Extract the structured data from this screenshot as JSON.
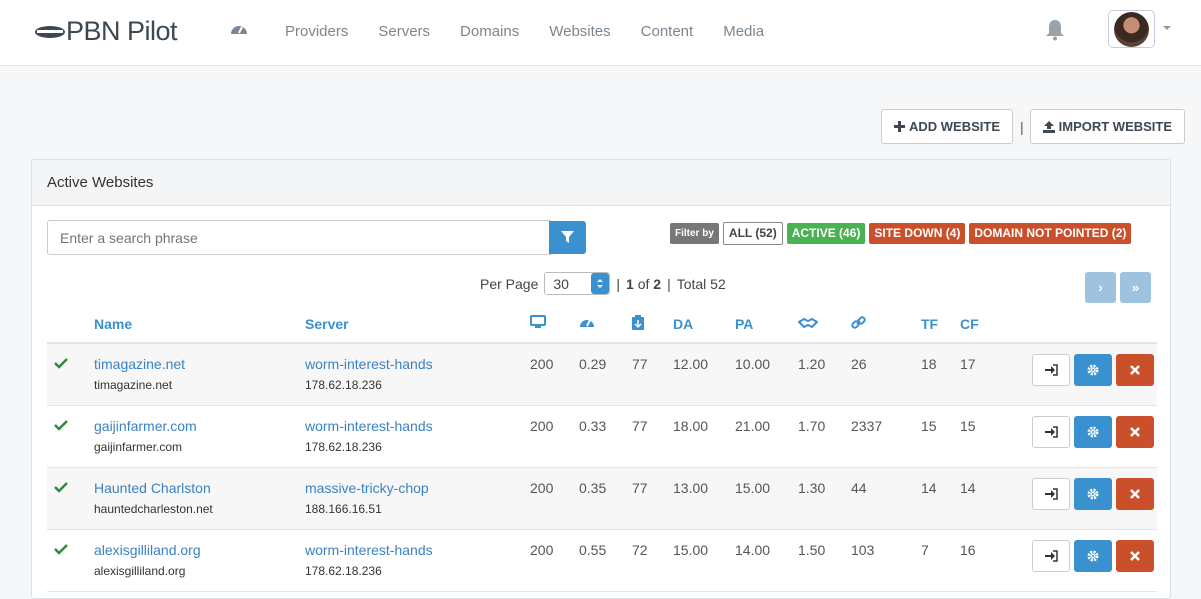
{
  "app": {
    "name": "PBN Pilot"
  },
  "nav": {
    "items": [
      "Providers",
      "Servers",
      "Domains",
      "Websites",
      "Content",
      "Media"
    ]
  },
  "actions": {
    "add": "ADD WEBSITE",
    "import": "IMPORT WEBSITE",
    "separator": "|"
  },
  "panel": {
    "title": "Active Websites"
  },
  "search": {
    "placeholder": "Enter a search phrase"
  },
  "filters": {
    "label": "Filter by",
    "all": "ALL (52)",
    "active": "ACTIVE (46)",
    "down": "SITE DOWN (4)",
    "not_pointed": "DOMAIN NOT POINTED (2)"
  },
  "pager": {
    "per_page_label": "Per Page",
    "per_page": "30",
    "bar1": "|",
    "page": "1",
    "of": "of",
    "total_pages": "2",
    "bar2": "|",
    "total": "Total 52",
    "next": "›",
    "last": "»"
  },
  "columns": {
    "name": "Name",
    "server": "Server",
    "da": "DA",
    "pa": "PA",
    "tf": "TF",
    "cf": "CF"
  },
  "rows": [
    {
      "name": "timagazine.net",
      "domain": "timagazine.net",
      "server": "worm-interest-hands",
      "ip": "178.62.18.236",
      "status": "200",
      "speed": "0.29",
      "score": "77",
      "da": "12.00",
      "pa": "10.00",
      "ratio": "1.20",
      "links": "26",
      "tf": "18",
      "cf": "17"
    },
    {
      "name": "gaijinfarmer.com",
      "domain": "gaijinfarmer.com",
      "server": "worm-interest-hands",
      "ip": "178.62.18.236",
      "status": "200",
      "speed": "0.33",
      "score": "77",
      "da": "18.00",
      "pa": "21.00",
      "ratio": "1.70",
      "links": "2337",
      "tf": "15",
      "cf": "15"
    },
    {
      "name": "Haunted Charlston",
      "domain": "hauntedcharleston.net",
      "server": "massive-tricky-chop",
      "ip": "188.166.16.51",
      "status": "200",
      "speed": "0.35",
      "score": "77",
      "da": "13.00",
      "pa": "15.00",
      "ratio": "1.30",
      "links": "44",
      "tf": "14",
      "cf": "14"
    },
    {
      "name": "alexisgilliland.org",
      "domain": "alexisgilliland.org",
      "server": "worm-interest-hands",
      "ip": "178.62.18.236",
      "status": "200",
      "speed": "0.55",
      "score": "72",
      "da": "15.00",
      "pa": "14.00",
      "ratio": "1.50",
      "links": "103",
      "tf": "7",
      "cf": "16"
    }
  ],
  "colors": {
    "accent": "#3a91d0",
    "success": "#4ab252",
    "danger": "#c9502a"
  }
}
